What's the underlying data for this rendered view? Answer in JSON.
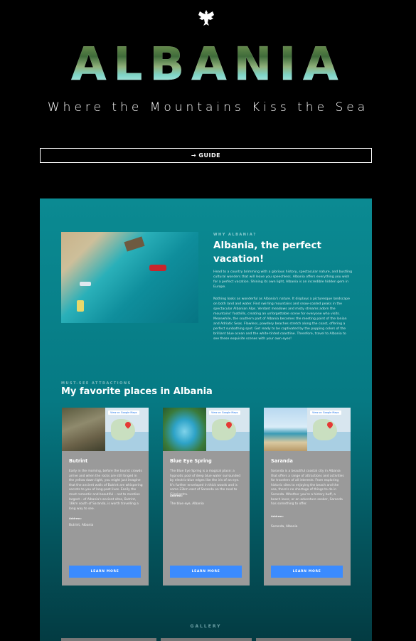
{
  "header": {
    "emblem_icon": "albanian-eagle-icon",
    "title": "ALBANIA",
    "tagline": "Where the Mountains Kiss the Sea",
    "guide_button": "→ GUIDE"
  },
  "why": {
    "eyebrow": "WHY ALBANIA?",
    "title": "Albania, the perfect vacation!",
    "paragraph1": "Head to a country brimming with a glorious history, spectacular nature, and bustling cultural wonders that will leave you speechless. Albania offers everything you wish for a perfect vacation. Shining its own light, Albania is an incredible hidden gem in Europe.",
    "paragraph2": "Nothing looks as wonderful as Albania's nature. It displays a picturesque landscape on both land and water. Find swirling mountains and snow-coated peaks in the spectacular Albanian Alps. Verdant meadows and misty streams adorn the mountains' foothills, creating an unforgettable scene for everyone who visits. Meanwhile, the southern part of Albania becomes the meeting point of the Ionian and Adriatic Seas. Flawless, powdery beaches stretch along the coast, offering a perfect sunbathing spot. Get ready to be captivated by the popping colors of the brilliant blue ocean and the white-tinted coastline. Therefore, travel to Albania to see these exquisite scenes with your own eyes!"
  },
  "attractions": {
    "eyebrow": "MUST-SEE ATTRACTIONS",
    "title": "My favorite places in Albania",
    "map_link_label": "View on Google Maps",
    "address_label": "Address:",
    "learn_more_label": "LEARN MORE",
    "cards": [
      {
        "name": "Butrint",
        "map_place": "Parco nazionale di Butrinto",
        "description": "Early in the morning, before the tourist crowds arrive and when the rocks are still tinged in the yellow dawn light, you might just imagine that the ancient walls of Butrint are whispering secrets to you of long-past lives. Easily the most romantic and beautiful – not to mention largest – of Albania's ancient sites, Butrint, 18km south of Saranda, is worth travelling a long way to see.",
        "address": "Butrint, Albania"
      },
      {
        "name": "Blue Eye Spring",
        "map_place": "Syri i Kaltër",
        "description": "The Blue Eye Spring is a magical place: a hypnotic pool of deep blue water surrounded by electric-blue edges like the iris of an eye. It's further enveloped in thick woods and is some 23km east of Saranda on the road to Gjirokastra.",
        "address": "The blue eye, Albania"
      },
      {
        "name": "Saranda",
        "map_place": "Sarandë",
        "description": "Saranda is a beautiful coastal city in Albania that offers a range of attractions and activities for travelers of all interests. From exploring historic sites to enjoying the beach and the sea, there's no shortage of things to do in Saranda. Whether you're a history buff, a beach lover, or an adventure seeker, Saranda has something to offer.",
        "address": "Saranda, Albania"
      }
    ]
  },
  "gallery": {
    "label": "GALLERY"
  },
  "colors": {
    "page_bg": "#000000",
    "panel_teal": "#0b8a92",
    "button_blue": "#3b8bff",
    "card_gray": "#9a9a9a"
  }
}
